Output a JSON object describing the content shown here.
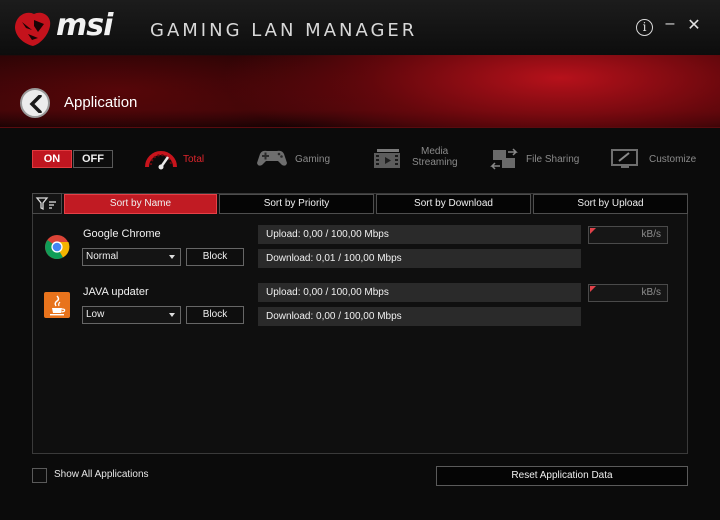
{
  "window": {
    "brand": "msi",
    "product": "GAMING LAN MANAGER",
    "controls": {
      "info": "i",
      "minimize": "–",
      "close": "✕"
    }
  },
  "header": {
    "title": "Application"
  },
  "power": {
    "on_label": "ON",
    "off_label": "OFF",
    "state": "ON"
  },
  "modes": [
    {
      "label": "Total",
      "icon": "speedometer-icon",
      "active": true
    },
    {
      "label": "Gaming",
      "icon": "gamepad-icon",
      "active": false
    },
    {
      "label": "Media\nStreaming",
      "line1": "Media",
      "line2": "Streaming",
      "icon": "film-icon",
      "active": false
    },
    {
      "label": "File Sharing",
      "icon": "file-transfer-icon",
      "active": false
    },
    {
      "label": "Customize",
      "icon": "monitor-edit-icon",
      "active": false
    }
  ],
  "sort_tabs": [
    {
      "label": "Sort by Name",
      "active": true
    },
    {
      "label": "Sort by Priority",
      "active": false
    },
    {
      "label": "Sort by Download",
      "active": false
    },
    {
      "label": "Sort by Upload",
      "active": false
    }
  ],
  "apps": [
    {
      "name": "Google Chrome",
      "icon": "chrome-icon",
      "priority": "Normal",
      "block_label": "Block",
      "upload": "Upload: 0,00 / 100,00 Mbps",
      "download": "Download: 0,01 / 100,00 Mbps",
      "limit_unit": "kB/s"
    },
    {
      "name": "JAVA updater",
      "icon": "java-icon",
      "priority": "Low",
      "block_label": "Block",
      "upload": "Upload: 0,00 / 100,00 Mbps",
      "download": "Download: 0,00 / 100,00 Mbps",
      "limit_unit": "kB/s"
    }
  ],
  "footer": {
    "show_all_label": "Show All Applications",
    "show_all_checked": false,
    "reset_label": "Reset Application Data"
  },
  "colors": {
    "accent": "#c01620",
    "background": "#0b0b0b",
    "inactive_text": "#8a8a8a"
  }
}
